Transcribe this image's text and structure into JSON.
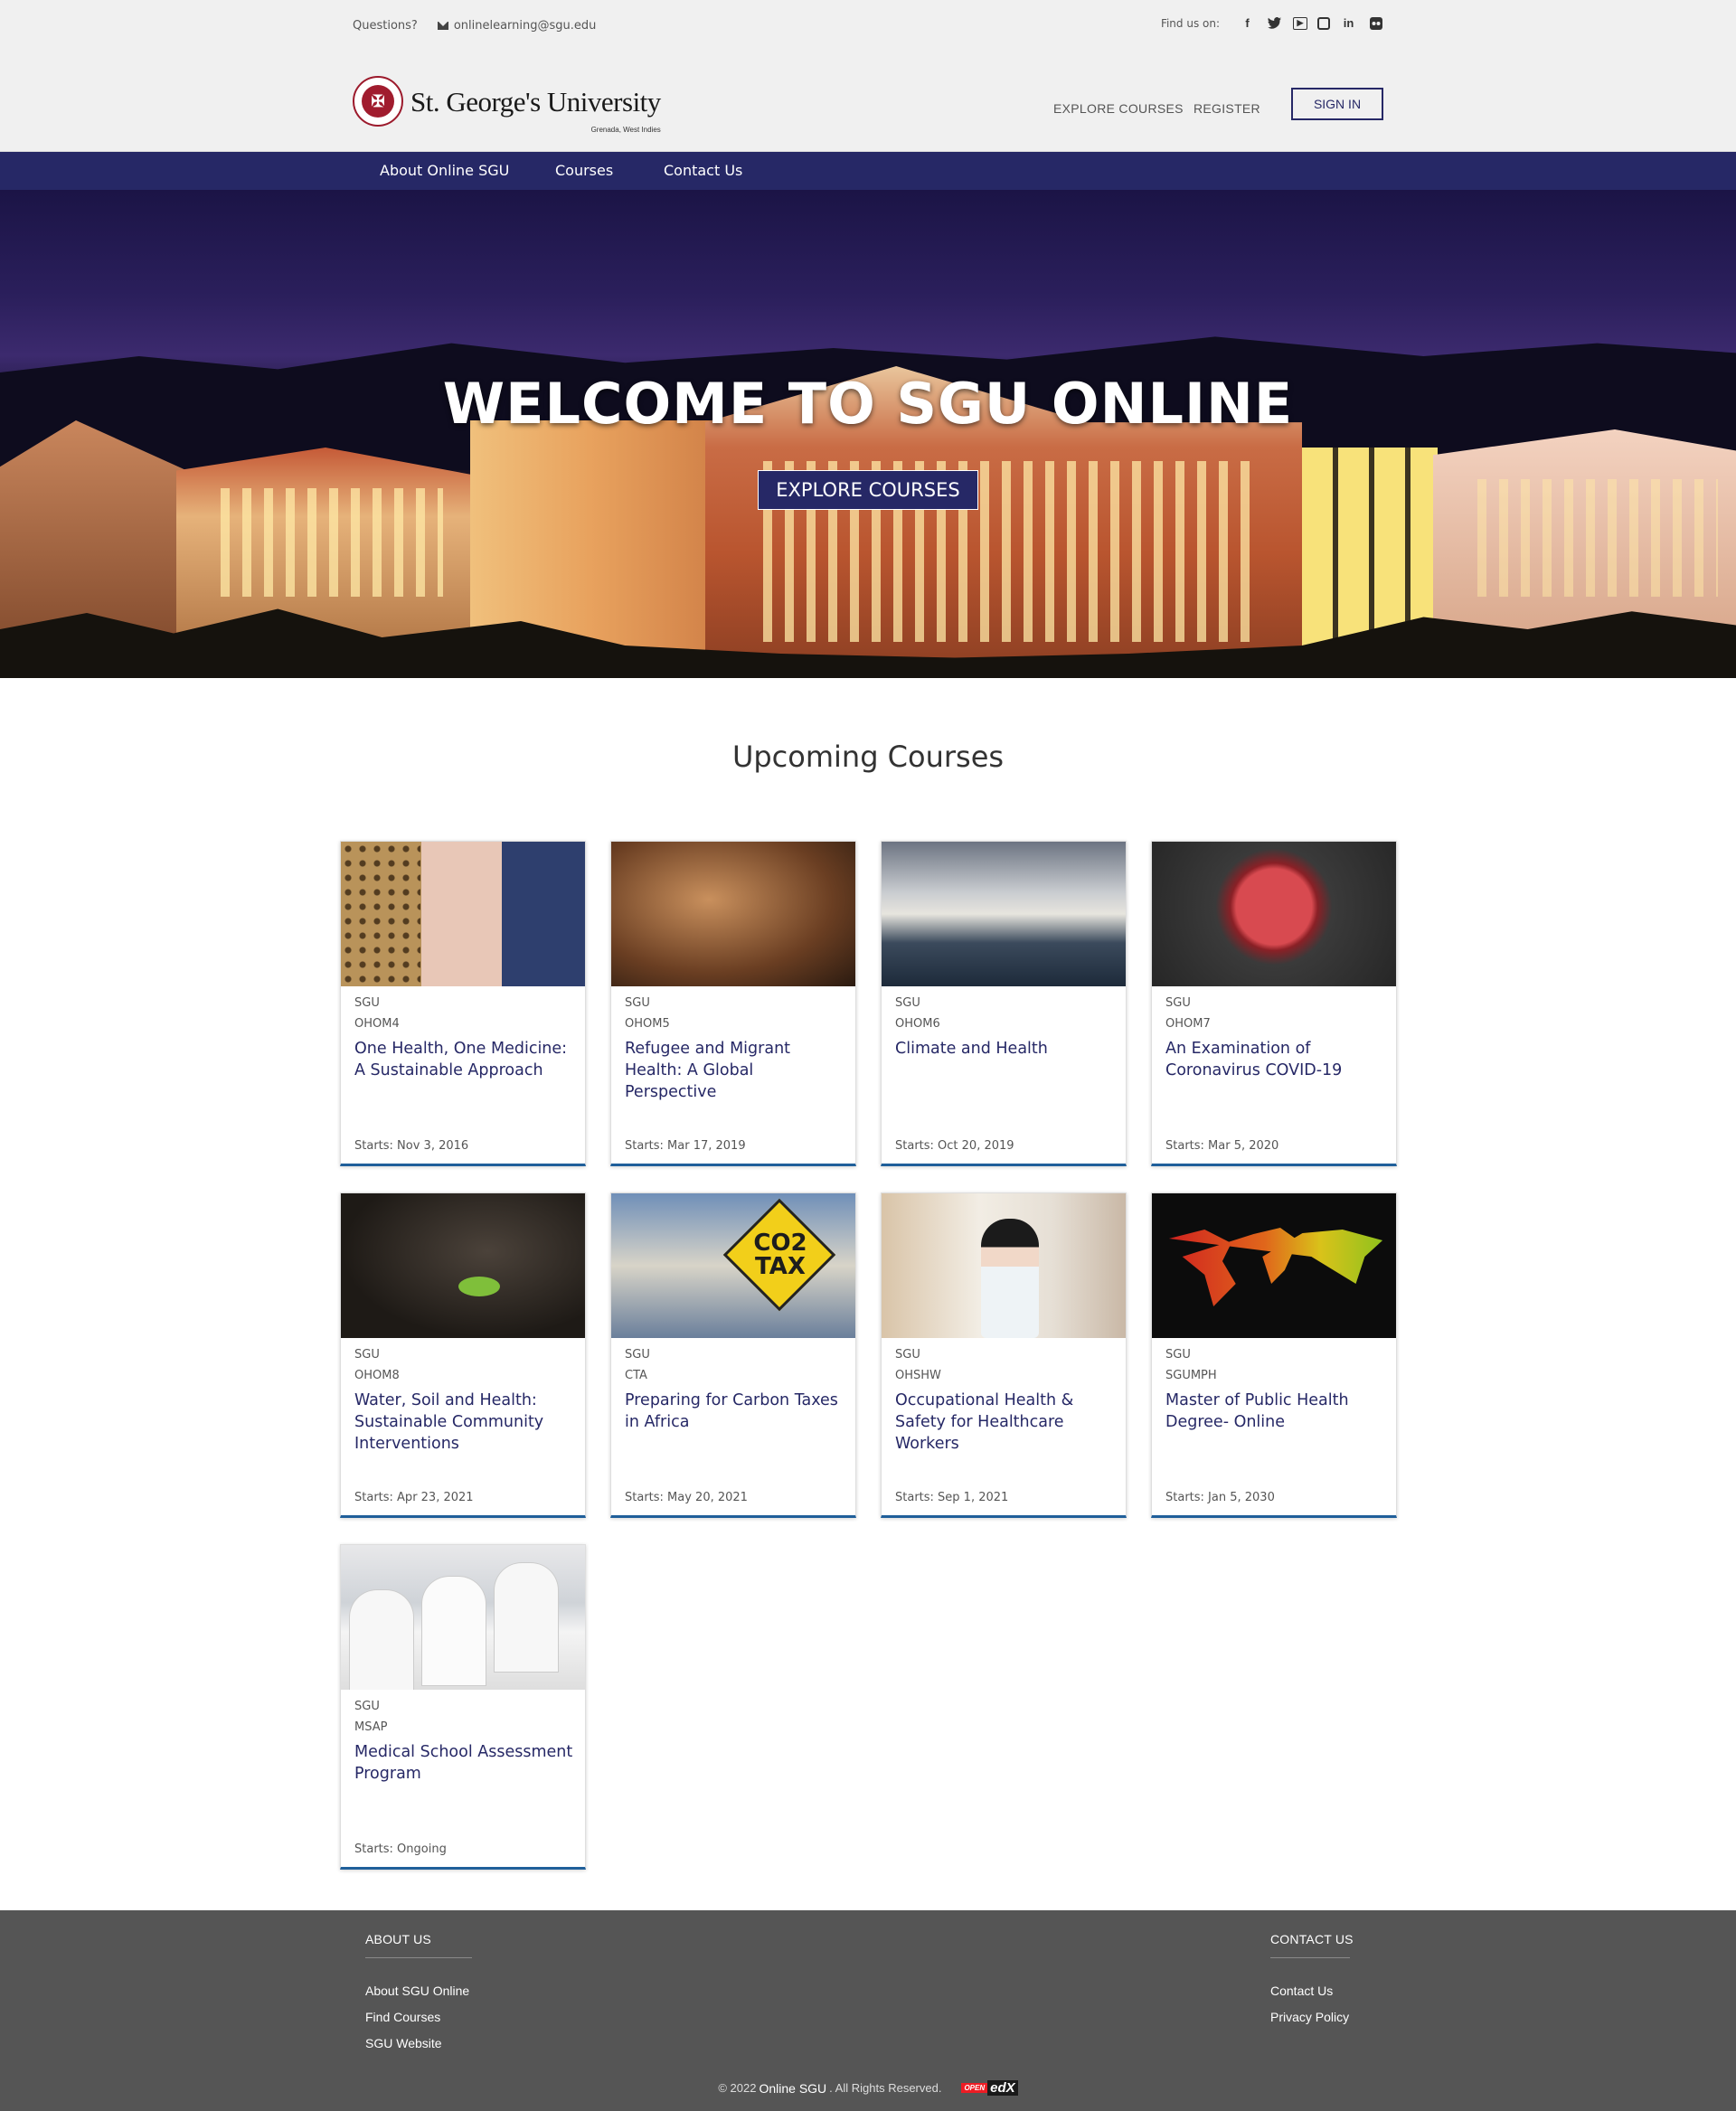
{
  "topbar": {
    "questions_label": "Questions?",
    "email": "onlinelearning@sgu.edu",
    "find_us_label": "Find us on:",
    "social": [
      "facebook-icon",
      "twitter-icon",
      "youtube-icon",
      "instagram-icon",
      "linkedin-icon",
      "flickr-icon"
    ]
  },
  "header": {
    "logo_name": "St. George's University",
    "logo_sub": "Grenada, West Indies",
    "explore_label": "EXPLORE COURSES",
    "register_label": "REGISTER",
    "signin_label": "SIGN IN"
  },
  "nav": {
    "items": [
      "About Online SGU",
      "Courses",
      "Contact Us"
    ]
  },
  "hero": {
    "title": "WELCOME TO SGU ONLINE",
    "button_label": "EXPLORE COURSES"
  },
  "courses": {
    "heading": "Upcoming Courses",
    "items": [
      {
        "org": "SGU",
        "code": "OHOM4",
        "title": "One Health, One Medicine: A Sustainable Approach",
        "start": "Starts: Nov 3, 2016"
      },
      {
        "org": "SGU",
        "code": "OHOM5",
        "title": "Refugee and Migrant Health: A Global Perspective",
        "start": "Starts: Mar 17, 2019"
      },
      {
        "org": "SGU",
        "code": "OHOM6",
        "title": "Climate and Health",
        "start": "Starts: Oct 20, 2019"
      },
      {
        "org": "SGU",
        "code": "OHOM7",
        "title": "An Examination of Coronavirus COVID-19",
        "start": "Starts: Mar 5, 2020"
      },
      {
        "org": "SGU",
        "code": "OHOM8",
        "title": "Water, Soil and Health: Sustainable Community Interventions",
        "start": "Starts: Apr 23, 2021"
      },
      {
        "org": "SGU",
        "code": "CTA",
        "title": "Preparing for Carbon Taxes in Africa",
        "start": "Starts: May 20, 2021",
        "image_text": "CO2 TAX"
      },
      {
        "org": "SGU",
        "code": "OHSHW",
        "title": "Occupational Health & Safety for Healthcare Workers",
        "start": "Starts: Sep 1, 2021"
      },
      {
        "org": "SGU",
        "code": "SGUMPH",
        "title": "Master of Public Health Degree- Online",
        "start": "Starts: Jan 5, 2030"
      },
      {
        "org": "SGU",
        "code": "MSAP",
        "title": "Medical School Assessment Program",
        "start": "Starts: Ongoing"
      }
    ]
  },
  "footer": {
    "about_heading": "ABOUT US",
    "about_links": [
      "About SGU Online",
      "Find Courses",
      "SGU Website"
    ],
    "contact_heading": "CONTACT US",
    "contact_links": [
      "Contact Us",
      "Privacy Policy"
    ],
    "copyright_prefix": "© 2022",
    "copyright_brand": "Online SGU",
    "copyright_suffix": ". All Rights Reserved.",
    "openedx_open": "OPEN",
    "openedx_edx": "edX"
  },
  "colors": {
    "brand_navy": "#262866",
    "card_accent": "#1f5f9a",
    "footer_bg": "#555555",
    "seal_red": "#a01c2e"
  }
}
